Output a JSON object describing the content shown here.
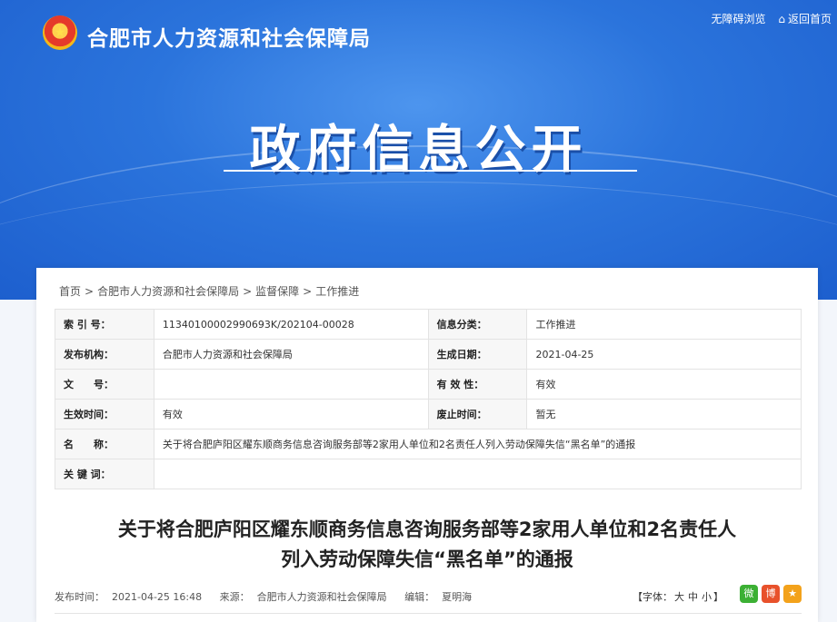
{
  "header": {
    "site_title": "合肥市人力资源和社会保障局",
    "accessibility": "无障碍浏览",
    "back_home": "返回首页",
    "hero": "政府信息公开"
  },
  "breadcrumb": [
    "首页",
    "合肥市人力资源和社会保障局",
    "监督保障",
    "工作推进"
  ],
  "meta": {
    "index_label": "索 引 号：",
    "index_value": "11340100002990693K/202104-00028",
    "category_label": "信息分类：",
    "category_value": "工作推进",
    "org_label": "发布机构：",
    "org_value": "合肥市人力资源和社会保障局",
    "date_label": "生成日期：",
    "date_value": "2021-04-25",
    "docno_label": "文　　号：",
    "docno_value": "",
    "valid_label": "有 效 性：",
    "valid_value": "有效",
    "effective_label": "生效时间：",
    "effective_value": "有效",
    "abolish_label": "废止时间：",
    "abolish_value": "暂无",
    "name_label": "名　　称：",
    "name_value": "关于将合肥庐阳区耀东顺商务信息咨询服务部等2家用人单位和2名责任人列入劳动保障失信“黑名单”的通报",
    "keyword_label": "关 键 词：",
    "keyword_value": ""
  },
  "article": {
    "title_line1": "关于将合肥庐阳区耀东顺商务信息咨询服务部等2家用人单位和2名责任人",
    "title_line2": "列入劳动保障失信“黑名单”的通报",
    "publish_label": "发布时间：",
    "publish_time": "2021-04-25 16:48",
    "source_label": "来源：",
    "source": "合肥市人力资源和社会保障局",
    "editor_label": "编辑：",
    "editor": "夏明海",
    "font_label": "【字体：",
    "font_large": "大",
    "font_medium": "中",
    "font_small": "小",
    "font_close": "】"
  },
  "share": {
    "wechat": "微",
    "weibo": "博",
    "favorite": "★"
  }
}
